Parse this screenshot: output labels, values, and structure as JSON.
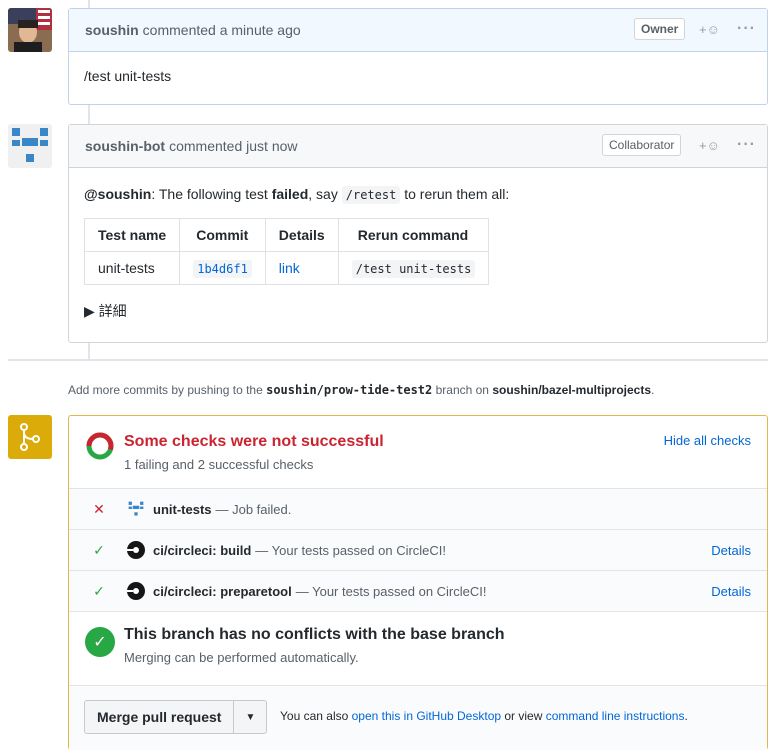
{
  "comments": [
    {
      "author": "soushin",
      "meta": "commented a minute ago",
      "badge": "Owner",
      "body": "/test unit-tests"
    },
    {
      "author": "soushin-bot",
      "meta": "commented just now",
      "badge": "Collaborator",
      "body": {
        "mention": "@soushin",
        "text1": ": The following test ",
        "strong": "failed",
        "text2": ", say ",
        "code": "/retest",
        "text3": " to rerun them all:"
      },
      "table": {
        "headers": [
          "Test name",
          "Commit",
          "Details",
          "Rerun command"
        ],
        "row": {
          "name": "unit-tests",
          "commit": "1b4d6f1",
          "details": "link",
          "rerun": "/test unit-tests"
        }
      },
      "details_summary": "▶ 詳細"
    }
  ],
  "reactions": {
    "add": "+☺",
    "more": "···"
  },
  "commits_hint": {
    "prefix": "Add more commits by pushing to the ",
    "branch": "soushin/prow-tide-test2",
    "middle": " branch on ",
    "repo": "soushin/bazel-multiprojects",
    "suffix": "."
  },
  "checks": {
    "title": "Some checks were not successful",
    "subtitle": "1 failing and 2 successful checks",
    "hide_link": "Hide all checks",
    "items": [
      {
        "status": "fail",
        "symbol": "✕",
        "name": "unit-tests",
        "desc": "— Job failed.",
        "details": ""
      },
      {
        "status": "pass",
        "symbol": "✓",
        "name": "ci/circleci: build",
        "desc": "— Your tests passed on CircleCI!",
        "details": "Details"
      },
      {
        "status": "pass",
        "symbol": "✓",
        "name": "ci/circleci: preparetool",
        "desc": "— Your tests passed on CircleCI!",
        "details": "Details"
      }
    ]
  },
  "conflicts": {
    "title": "This branch has no conflicts with the base branch",
    "subtitle": "Merging can be performed automatically.",
    "check_symbol": "✓"
  },
  "merge": {
    "button": "Merge pull request",
    "caret": "▼",
    "hint_prefix": "You can also ",
    "desktop_link": "open this in GitHub Desktop",
    "hint_middle": " or view ",
    "cli_link": "command line instructions",
    "hint_suffix": "."
  },
  "colors": {
    "fail": "#cb2431",
    "pass": "#28a745",
    "accent": "#0366d6",
    "merge_icon_bg": "#dbab09"
  }
}
